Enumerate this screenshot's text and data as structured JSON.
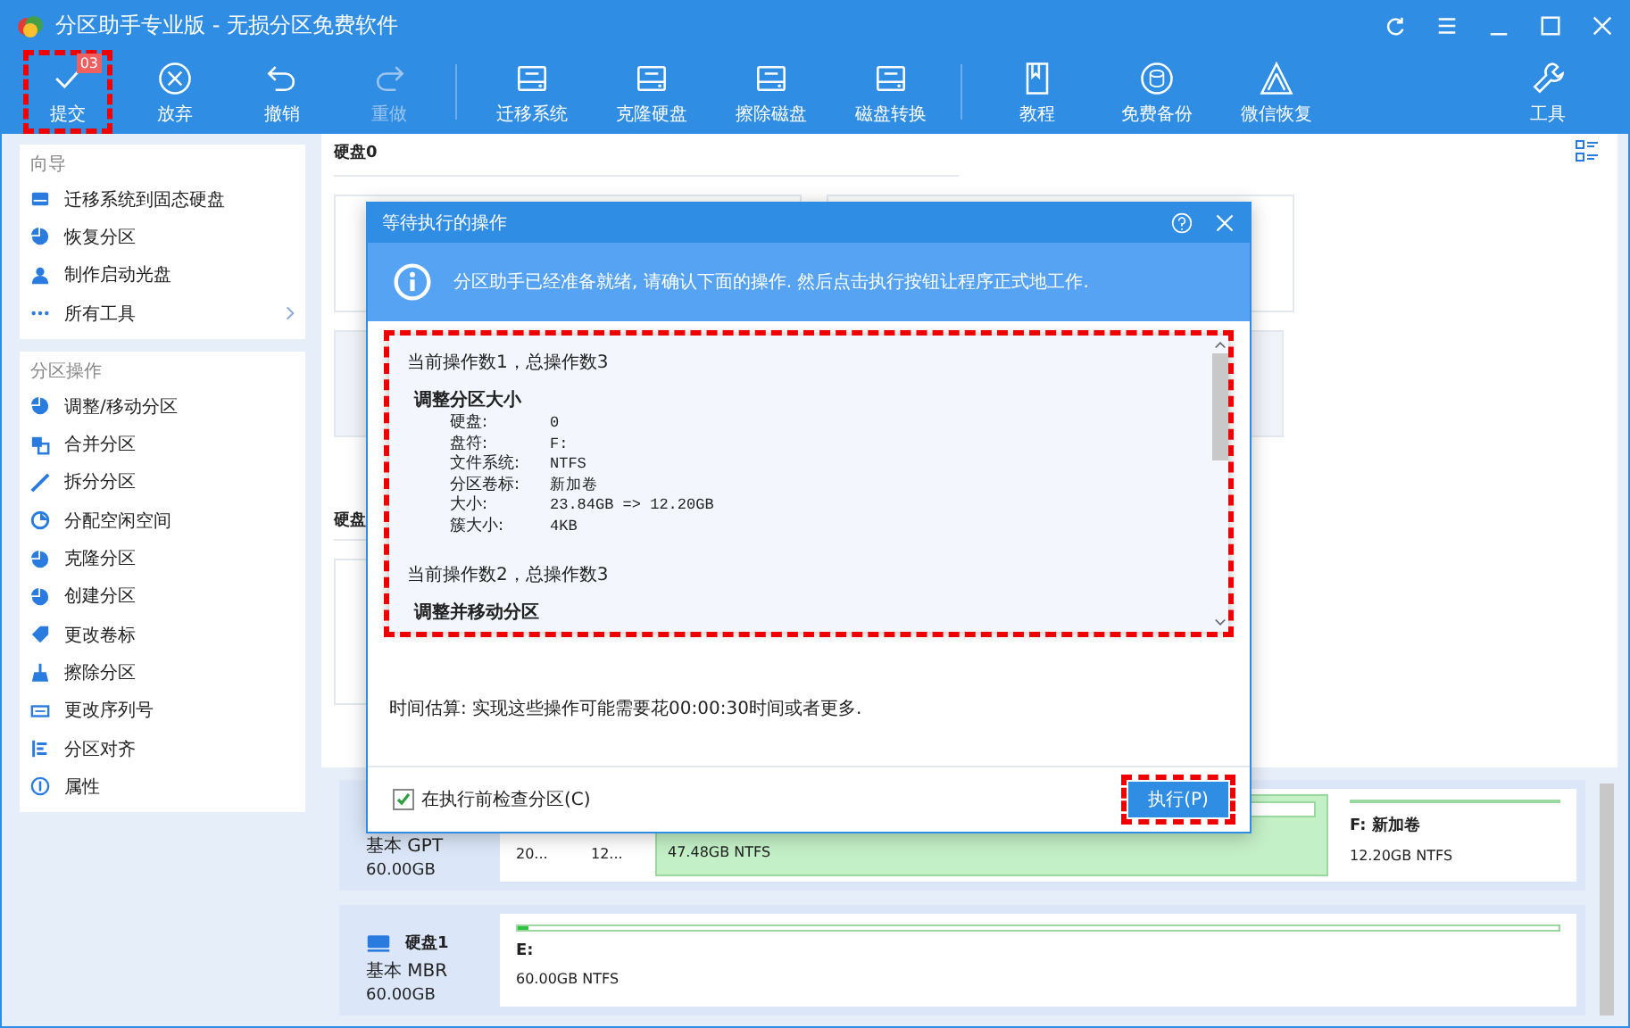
{
  "window": {
    "title": "分区助手专业版 - 无损分区免费软件"
  },
  "toolbar": {
    "items": [
      {
        "label": "提交",
        "badge": "03",
        "disabled": false,
        "highlighted": true
      },
      {
        "label": "放弃",
        "disabled": false,
        "highlighted": false
      },
      {
        "label": "撤销",
        "disabled": false,
        "highlighted": false
      },
      {
        "label": "重做",
        "disabled": true,
        "highlighted": false
      },
      {
        "label": "迁移系统",
        "disabled": false,
        "highlighted": false
      },
      {
        "label": "克隆硬盘",
        "disabled": false,
        "highlighted": false
      },
      {
        "label": "擦除磁盘",
        "disabled": false,
        "highlighted": false
      },
      {
        "label": "磁盘转换",
        "disabled": false,
        "highlighted": false
      },
      {
        "label": "教程",
        "disabled": false,
        "highlighted": false
      },
      {
        "label": "免费备份",
        "disabled": false,
        "highlighted": false
      },
      {
        "label": "微信恢复",
        "disabled": false,
        "highlighted": false
      }
    ],
    "tools": "工具"
  },
  "sidebar": {
    "sections": [
      {
        "title": "向导",
        "items": [
          {
            "label": "迁移系统到固态硬盘",
            "has_submenu": false
          },
          {
            "label": "恢复分区",
            "has_submenu": false
          },
          {
            "label": "制作启动光盘",
            "has_submenu": false
          },
          {
            "label": "所有工具",
            "has_submenu": true
          }
        ]
      },
      {
        "title": "分区操作",
        "items": [
          {
            "label": "调整/移动分区",
            "has_submenu": false
          },
          {
            "label": "合并分区",
            "has_submenu": false
          },
          {
            "label": "拆分分区",
            "has_submenu": false
          },
          {
            "label": "分配空闲空间",
            "has_submenu": false
          },
          {
            "label": "克隆分区",
            "has_submenu": false
          },
          {
            "label": "创建分区",
            "has_submenu": false
          },
          {
            "label": "更改卷标",
            "has_submenu": false
          },
          {
            "label": "擦除分区",
            "has_submenu": false
          },
          {
            "label": "更改序列号",
            "has_submenu": false
          },
          {
            "label": "分区对齐",
            "has_submenu": false
          },
          {
            "label": "属性",
            "has_submenu": false
          }
        ]
      }
    ]
  },
  "main": {
    "disk_heading": "硬盘0",
    "disk_heading_2": "硬盘"
  },
  "disks": [
    {
      "type": "基本 GPT",
      "size": "60.00GB",
      "partitions": [
        {
          "kind": "small",
          "label": "20..."
        },
        {
          "kind": "small",
          "label": "12..."
        },
        {
          "kind": "selected",
          "info": "47.48GB NTFS"
        },
        {
          "kind": "normal",
          "name": "F: 新加卷",
          "info": "12.20GB NTFS"
        }
      ]
    },
    {
      "name": "硬盘1",
      "type": "基本 MBR",
      "size": "60.00GB",
      "partitions": [
        {
          "kind": "normal",
          "name": "E:",
          "info": "60.00GB NTFS",
          "level": 0.01
        }
      ]
    }
  ],
  "dialog": {
    "title": "等待执行的操作",
    "info": "分区助手已经准备就绪, 请确认下面的操作. 然后点击执行按钮让程序正式地工作.",
    "operations": [
      {
        "header": "当前操作数1，总操作数3",
        "title": "调整分区大小",
        "fields": [
          {
            "label": "硬盘:",
            "value": "0"
          },
          {
            "label": "盘符:",
            "value": "F:"
          },
          {
            "label": "文件系统:",
            "value": "NTFS"
          },
          {
            "label": "分区卷标:",
            "value": "新加卷"
          },
          {
            "label": "大小:",
            "value": "23.84GB => 12.20GB"
          },
          {
            "label": "簇大小:",
            "value": "4KB"
          }
        ]
      },
      {
        "header": "当前操作数2，总操作数3",
        "title": "调整并移动分区"
      }
    ],
    "estimate": "时间估算: 实现这些操作可能需要花00:00:30时间或者更多.",
    "check": {
      "label": "在执行前检查分区(C)",
      "checked": true
    },
    "execute": "执行(P)"
  }
}
